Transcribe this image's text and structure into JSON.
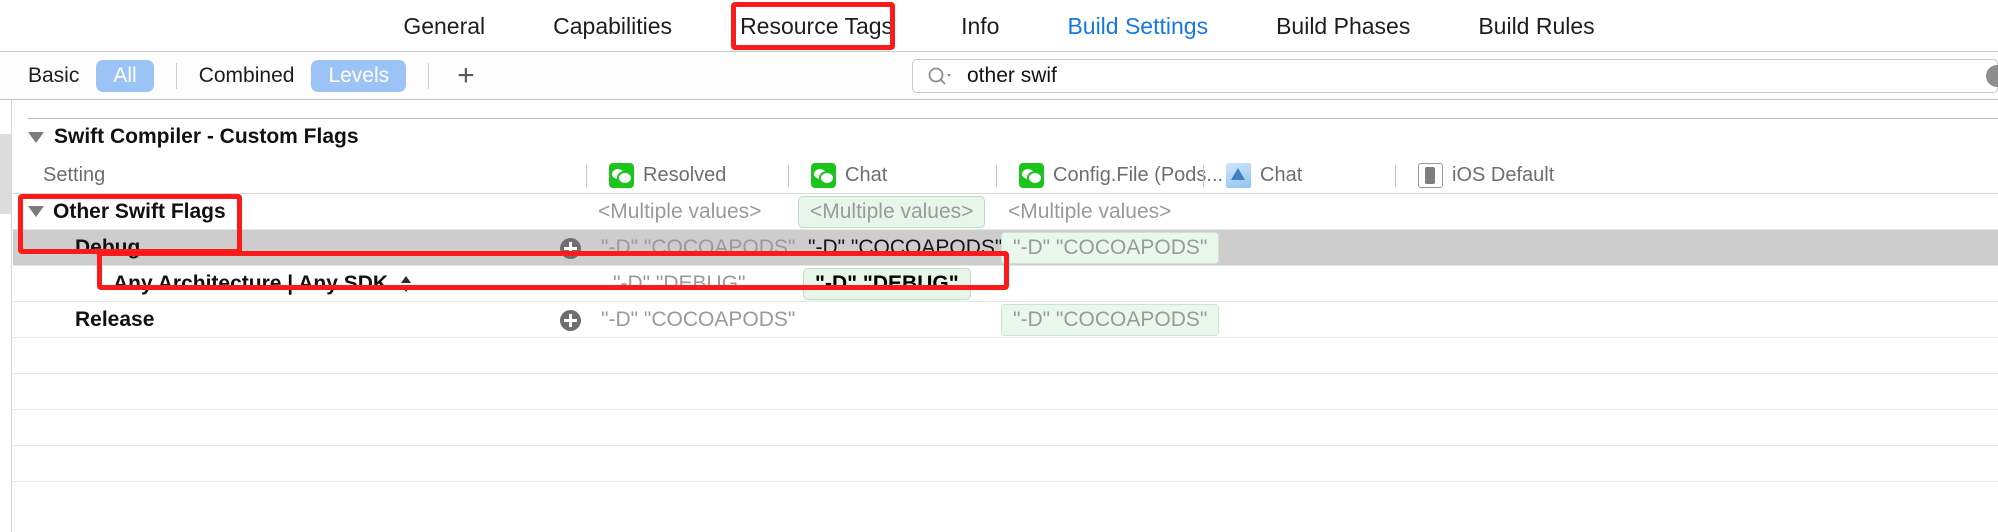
{
  "tabs": [
    {
      "label": "General",
      "active": false
    },
    {
      "label": "Capabilities",
      "active": false
    },
    {
      "label": "Resource Tags",
      "active": false
    },
    {
      "label": "Info",
      "active": false
    },
    {
      "label": "Build Settings",
      "active": true
    },
    {
      "label": "Build Phases",
      "active": false
    },
    {
      "label": "Build Rules",
      "active": false
    }
  ],
  "filterbar": {
    "basic": "Basic",
    "all": "All",
    "combined": "Combined",
    "levels": "Levels",
    "add": "+",
    "search_value": "other swif",
    "search_icon": "search-icon",
    "clear_icon": "clear-icon"
  },
  "section": {
    "title": "Swift Compiler - Custom Flags",
    "disclosure_icon": "triangle-down-icon"
  },
  "columns": [
    {
      "label": "Setting",
      "icon": "none"
    },
    {
      "label": "Resolved",
      "icon": "wechat-icon"
    },
    {
      "label": "Chat",
      "icon": "wechat-icon"
    },
    {
      "label": "Config.File (Pods...",
      "icon": "wechat-icon"
    },
    {
      "label": "Chat",
      "icon": "document-icon"
    },
    {
      "label": "iOS Default",
      "icon": "ios-device-icon"
    }
  ],
  "rows": [
    {
      "name": "Other Swift Flags",
      "indent": 0,
      "bold": true,
      "disclosure": true,
      "selected": false,
      "plus": false,
      "stepper": false,
      "values": [
        {
          "text": "<Multiple values>",
          "style": "gray"
        },
        {
          "text": "<Multiple values>",
          "style": "green-outline"
        },
        {
          "text": "<Multiple values>",
          "style": "gray"
        },
        {
          "text": "",
          "style": "gray"
        }
      ]
    },
    {
      "name": "Debug",
      "indent": 1,
      "bold": true,
      "disclosure": false,
      "selected": true,
      "plus": true,
      "stepper": false,
      "values": [
        {
          "text": "\"-D\" \"COCOAPODS\"",
          "style": "gray"
        },
        {
          "text": "\"-D\" \"COCOAPODS\"",
          "style": "dark"
        },
        {
          "text": "\"-D\" \"COCOAPODS\"",
          "style": "green-plain"
        },
        {
          "text": "",
          "style": "gray"
        }
      ]
    },
    {
      "name": "Any Architecture | Any SDK",
      "indent": 2,
      "bold": true,
      "disclosure": false,
      "selected": false,
      "plus": false,
      "stepper": true,
      "values": [
        {
          "text": "\"-D\" \"DEBUG\"",
          "style": "gray"
        },
        {
          "text": "\"-D\" \"DEBUG\"",
          "style": "bold"
        },
        {
          "text": "",
          "style": "gray"
        },
        {
          "text": "",
          "style": "gray"
        }
      ]
    },
    {
      "name": "Release",
      "indent": 1,
      "bold": true,
      "disclosure": false,
      "selected": false,
      "plus": true,
      "stepper": false,
      "values": [
        {
          "text": "\"-D\" \"COCOAPODS\"",
          "style": "gray"
        },
        {
          "text": "",
          "style": "gray"
        },
        {
          "text": "\"-D\" \"COCOAPODS\"",
          "style": "green-plain"
        },
        {
          "text": "",
          "style": "gray"
        }
      ]
    }
  ],
  "annotations": [
    {
      "name": "annotation-build-settings-tab"
    },
    {
      "name": "annotation-other-swift-flags-debug"
    },
    {
      "name": "annotation-any-architecture-row"
    },
    {
      "name": "annotation-debug-value"
    }
  ],
  "colors": {
    "accent_blue": "#1578e6",
    "pill_blue": "#9cc3f5",
    "annotation_red": "#fb1b1b",
    "selected_row": "#cdcdcd",
    "green_value_bg": "#e8f6ea",
    "wechat_green": "#1bc51b"
  }
}
